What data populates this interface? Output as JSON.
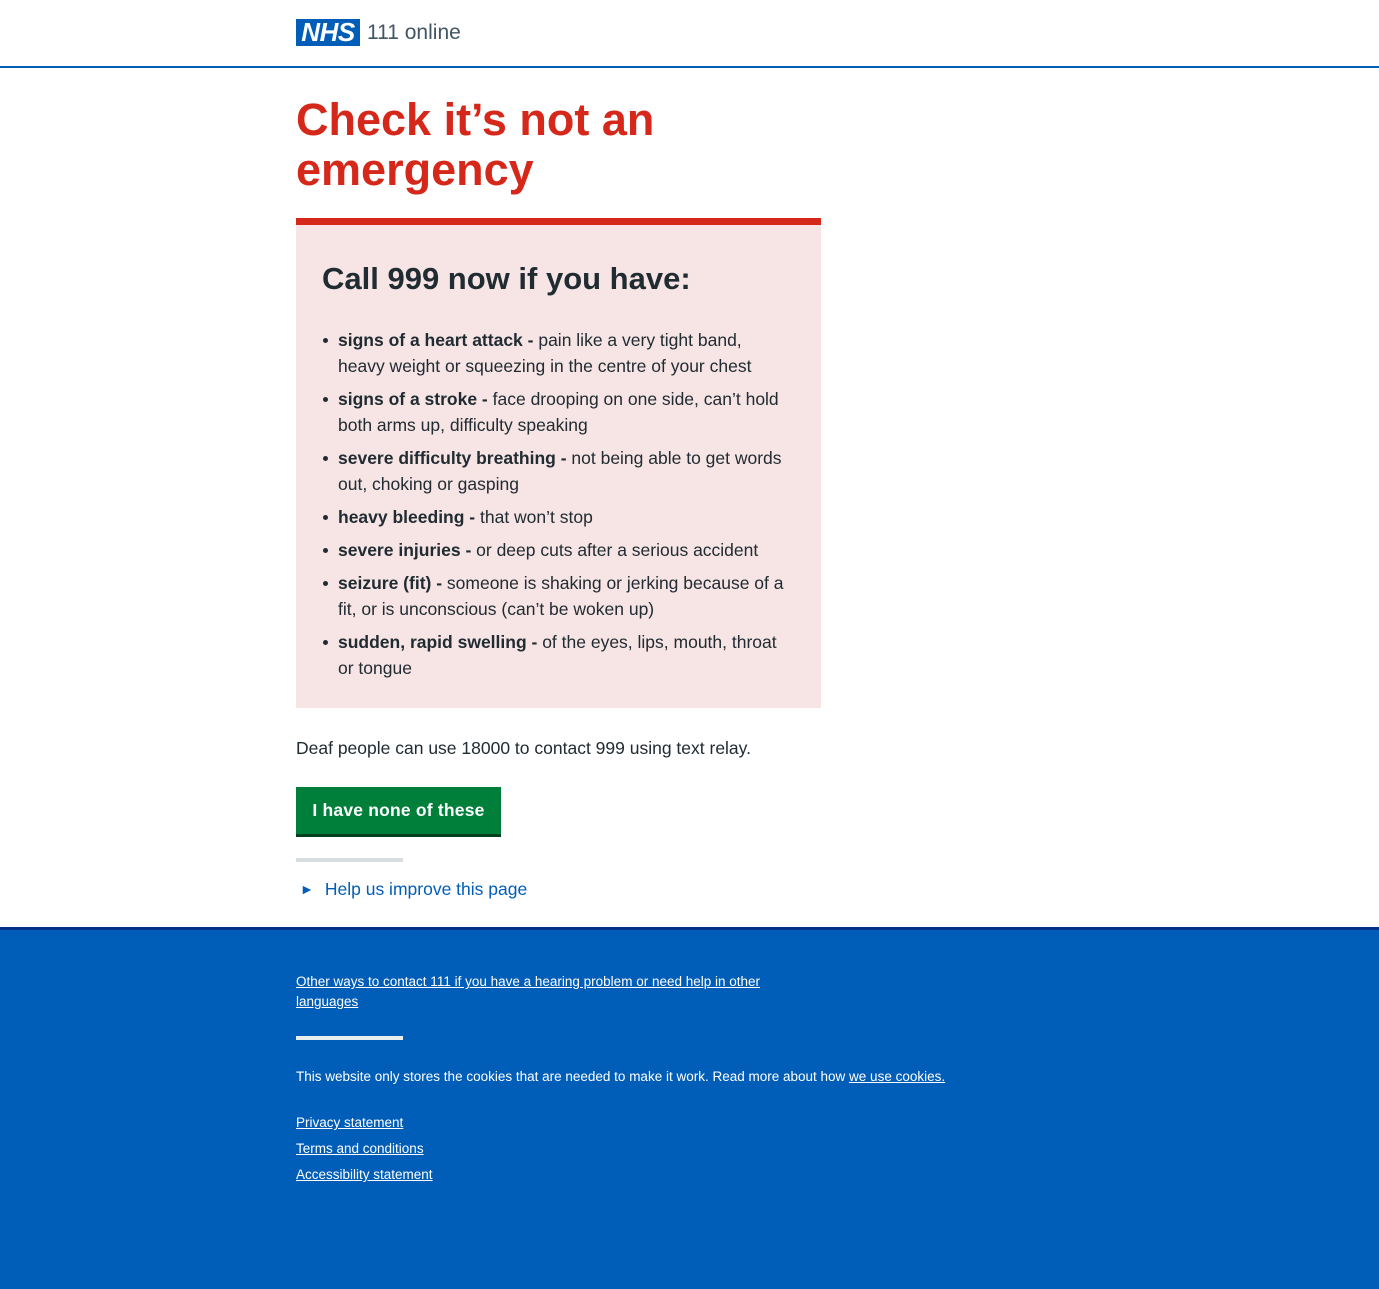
{
  "header": {
    "logo_text": "NHS",
    "service_name": "111 online"
  },
  "main": {
    "title": "Check it’s not an emergency",
    "care_card": {
      "heading": "Call 999 now if you have:",
      "items": [
        {
          "bold": "signs of a heart attack -",
          "text": " pain like a very tight band, heavy weight or squeezing in the centre of your chest"
        },
        {
          "bold": "signs of a stroke -",
          "text": " face drooping on one side, can’t hold both arms up, difficulty speaking"
        },
        {
          "bold": "severe difficulty breathing -",
          "text": " not being able to get words out, choking or gasping"
        },
        {
          "bold": "heavy bleeding -",
          "text": " that won’t stop"
        },
        {
          "bold": "severe injuries -",
          "text": " or deep cuts after a serious accident"
        },
        {
          "bold": "seizure (fit) -",
          "text": " someone is shaking or jerking because of a fit, or is unconscious (can’t be woken up)"
        },
        {
          "bold": "sudden, rapid swelling -",
          "text": " of the eyes, lips, mouth, throat or tongue"
        }
      ]
    },
    "deaf_text": "Deaf people can use 18000 to contact 999 using text relay.",
    "button_label": "I have none of these",
    "feedback_arrow": "►",
    "feedback_label": "Help us improve this page"
  },
  "footer": {
    "contact_link": "Other ways to contact 111 if you have a hearing problem or need help in other languages",
    "cookie_text": "This website only stores the cookies that are needed to make it work. Read more about how ",
    "cookie_link": "we use cookies.",
    "links": [
      "Privacy statement",
      "Terms and conditions",
      "Accessibility statement"
    ]
  },
  "colors": {
    "nhs_blue": "#005eb8",
    "emergency_red": "#d5281b",
    "care_card_bg": "#f6e5e4",
    "button_green": "#007f3b"
  }
}
